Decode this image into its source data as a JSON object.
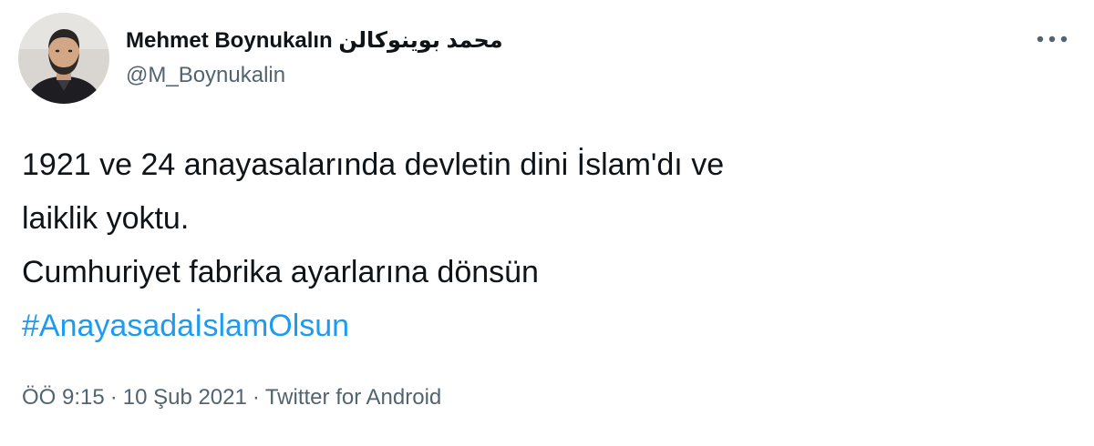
{
  "tweet": {
    "author": {
      "display_name": "Mehmet Boynukalın محمد بوينوكالن",
      "handle": "@M_Boynukalin",
      "avatar_icon": "profile-photo"
    },
    "more_icon": "more-options-icon",
    "lines": [
      "1921 ve 24 anayasalarında devletin dini İslam'dı ve",
      "laiklik yoktu.",
      "Cumhuriyet fabrika ayarlarına dönsün"
    ],
    "hashtag": "#AnayasadaİslamOlsun",
    "time": "ÖÖ 9:15",
    "date": "10 Şub 2021",
    "separator": "·",
    "source": "Twitter for Android"
  },
  "colors": {
    "text": "#0f1419",
    "secondary": "#536471",
    "link": "#1d9bf0",
    "background": "#ffffff"
  }
}
